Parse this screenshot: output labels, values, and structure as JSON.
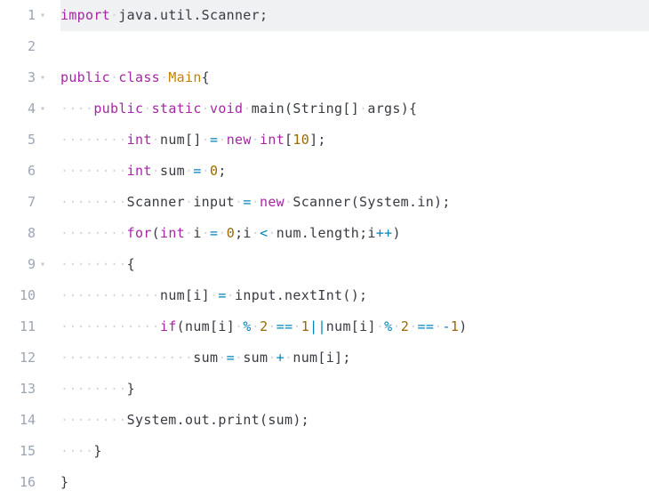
{
  "code": {
    "totalLines": 16,
    "foldMarkers": [
      1,
      3,
      4,
      9
    ],
    "highlightedLine": 1,
    "indentChar": "·",
    "tokens": {
      "import": "import",
      "public": "public",
      "class": "class",
      "static": "static",
      "void": "void",
      "int": "int",
      "new": "new",
      "for": "for",
      "if": "if",
      "Main": "Main",
      "Scanner": "Scanner",
      "String": "String",
      "System": "System",
      "main": "main",
      "num": "num",
      "sum": "sum",
      "input": "input",
      "args": "args",
      "i": "i",
      "in": "in",
      "length": "length",
      "nextInt": "nextInt",
      "out": "out",
      "print": "print",
      "javaUtilScanner": "java.util.Scanner",
      "zero": "0",
      "one": "1",
      "negOne": "-1",
      "two": "2",
      "ten": "10"
    },
    "lines": [
      "import java.util.Scanner;",
      "",
      "public class Main{",
      "    public static void main(String[] args){",
      "        int num[] = new int[10];",
      "        int sum = 0;",
      "        Scanner input = new Scanner(System.in);",
      "        for(int i = 0;i < num.length;i++)",
      "        {",
      "            num[i] = input.nextInt();",
      "            if(num[i] % 2 == 1||num[i] % 2 == -1)",
      "                sum = sum + num[i];",
      "        }",
      "        System.out.print(sum);",
      "    }",
      "}"
    ]
  },
  "colors": {
    "keyword": "#a626a4",
    "class": "#c18401",
    "number": "#986801",
    "operator": "#0184bc",
    "builtin": "#e45649",
    "text": "#383a42",
    "lineNumber": "#9da5b4",
    "whitespace": "#d4d6d8",
    "highlight": "#f0f1f2"
  }
}
